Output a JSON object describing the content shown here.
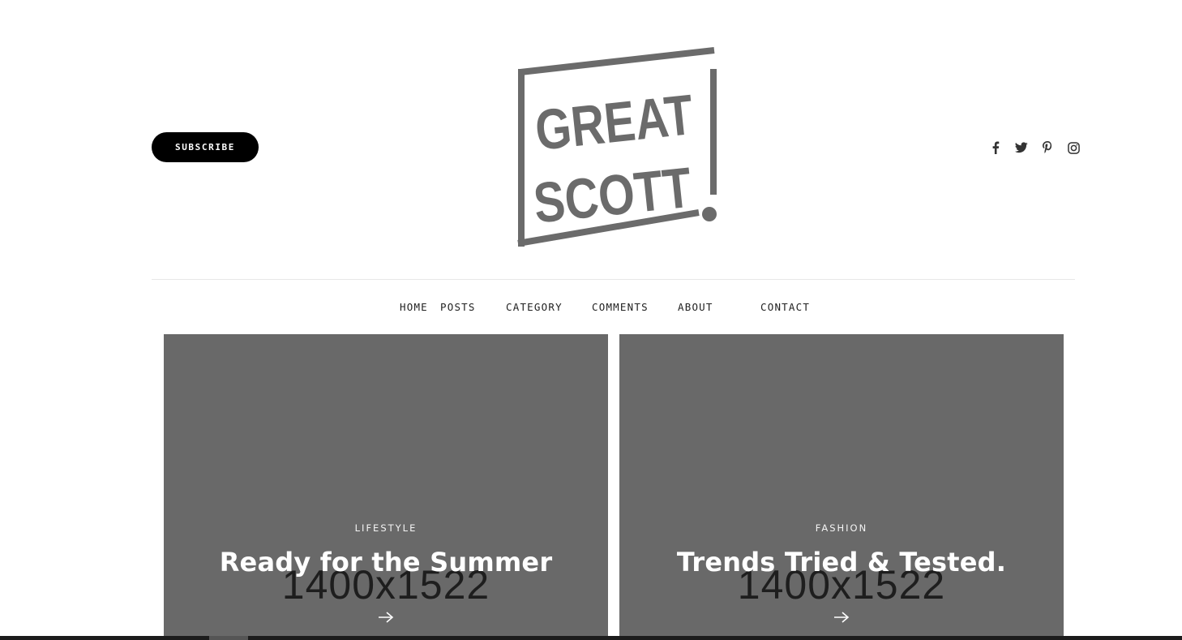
{
  "header": {
    "subscribe_label": "SUBSCRIBE",
    "logo": {
      "line1": "GREAT",
      "line2": "SCOTT",
      "color": "#6b6b6b"
    },
    "social_icons": [
      "facebook-icon",
      "twitter-icon",
      "pinterest-icon",
      "instagram-icon"
    ]
  },
  "nav": {
    "items": [
      {
        "label": "HOME"
      },
      {
        "label": "POSTS"
      },
      {
        "label": "CATEGORY"
      },
      {
        "label": "COMMENTS"
      },
      {
        "label": "ABOUT"
      },
      {
        "label": "CONTACT"
      }
    ]
  },
  "cards": [
    {
      "category": "LIFESTYLE",
      "title": "Ready for the Summer",
      "placeholder": "1400x1522"
    },
    {
      "category": "FASHION",
      "title": "Trends Tried & Tested.",
      "placeholder": "1400x1522"
    }
  ],
  "colors": {
    "card_background": "#696969",
    "button_background": "#000000",
    "text": "#222222"
  }
}
